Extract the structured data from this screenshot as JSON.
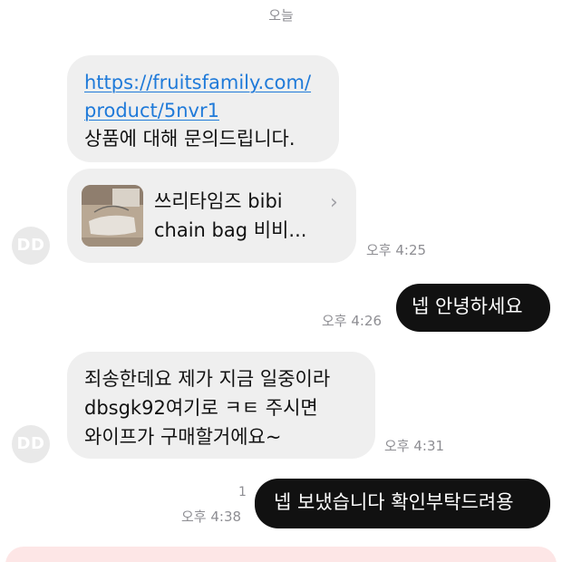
{
  "date_separator": "오늘",
  "messages": {
    "link_message": {
      "url_line1": "https://fruitsfamily.com/",
      "url_line2": "product/5nvr1",
      "text": "상품에 대해 문의드립니다."
    },
    "product_card": {
      "title_line1": "쓰리타임즈 bibi",
      "title_line2": "chain bag 비비...",
      "chevron": "›",
      "image_icon": "product-thumbnail-icon"
    },
    "time_1": "오후 4:25",
    "reply_1": "넵 안녕하세요",
    "time_2": "오후 4:26",
    "incoming_2": {
      "line1": "죄송한데요 제가 지금 일중이라",
      "line2": "dbsgk92여기로 ㅋㅌ 주시면",
      "line3": "와이프가 구매할거에요~"
    },
    "time_3": "오후 4:31",
    "reply_2": "넵 보냈습니다 확인부탁드려용",
    "time_4": "오후 4:38",
    "read_count": "1"
  },
  "avatar_initials": "DD",
  "colors": {
    "incoming_bubble": "#efefef",
    "outgoing_bubble": "#111111",
    "link": "#1f7ad9",
    "timestamp": "#8e8e93",
    "avatar": "#e9e9e9",
    "banner": "#fde6e6"
  }
}
